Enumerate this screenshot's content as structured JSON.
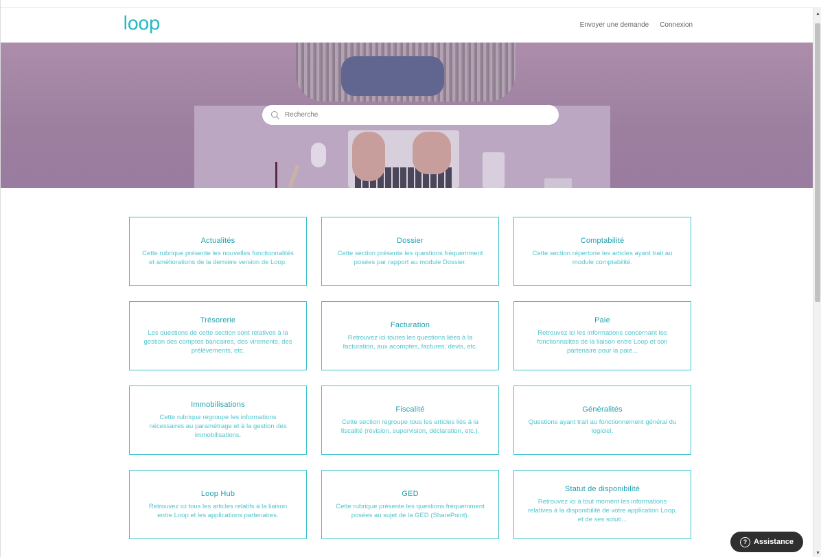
{
  "header": {
    "logo": "loop",
    "nav": [
      "Envoyer une demande",
      "Connexion"
    ]
  },
  "search": {
    "placeholder": "Recherche"
  },
  "categories": [
    {
      "title": "Actualités",
      "desc": "Cette rubrique présente les nouvelles fonctionnalités et améliorations de la dernière version de Loop."
    },
    {
      "title": "Dossier",
      "desc": "Cette section présente les questions fréquemment posées par rapport au module Dossier."
    },
    {
      "title": "Comptabilité",
      "desc": "Cette section répertorie les articles ayant trait au module comptabilité."
    },
    {
      "title": "Trésorerie",
      "desc": "Les questions de cette section sont relatives à la gestion des comptes bancaires, des virements, des prélèvements, etc."
    },
    {
      "title": "Facturation",
      "desc": "Retrouvez ici toutes les questions liées à la facturation, aux acomptes, factures, devis, etc."
    },
    {
      "title": "Paie",
      "desc": "Retrouvez ici les informations concernant les fonctionnalités de la liaison entre Loop et son partenaire pour la paie..."
    },
    {
      "title": "Immobilisations",
      "desc": "Cette rubrique regroupe les informations nécessaires au paramétrage et à la gestion des immobilisations."
    },
    {
      "title": "Fiscalité",
      "desc": "Cette section regroupe tous les articles liés à la fiscalité (révision, supervision, déclaration, etc.)."
    },
    {
      "title": "Généralités",
      "desc": "Questions ayant trait au fonctionnement général du logiciel."
    },
    {
      "title": "Loop Hub",
      "desc": "Retrouvez ici tous les articles relatifs à la liaison entre Loop et les applications partenaires."
    },
    {
      "title": "GED",
      "desc": "Cette rubrique présente les questions fréquemment posées au sujet de la GED (SharePoint)."
    },
    {
      "title": "Statut de disponibilité",
      "desc": "Retrouvez ici à tout moment les informations relatives à la disponibilité de votre application Loop, et de ses soluti..."
    }
  ],
  "assistance": {
    "label": "Assistance",
    "icon": "?"
  },
  "colors": {
    "accent": "#26b9c6",
    "card_border": "#3cc3cc",
    "hero_tint": "#9c7e9f"
  }
}
